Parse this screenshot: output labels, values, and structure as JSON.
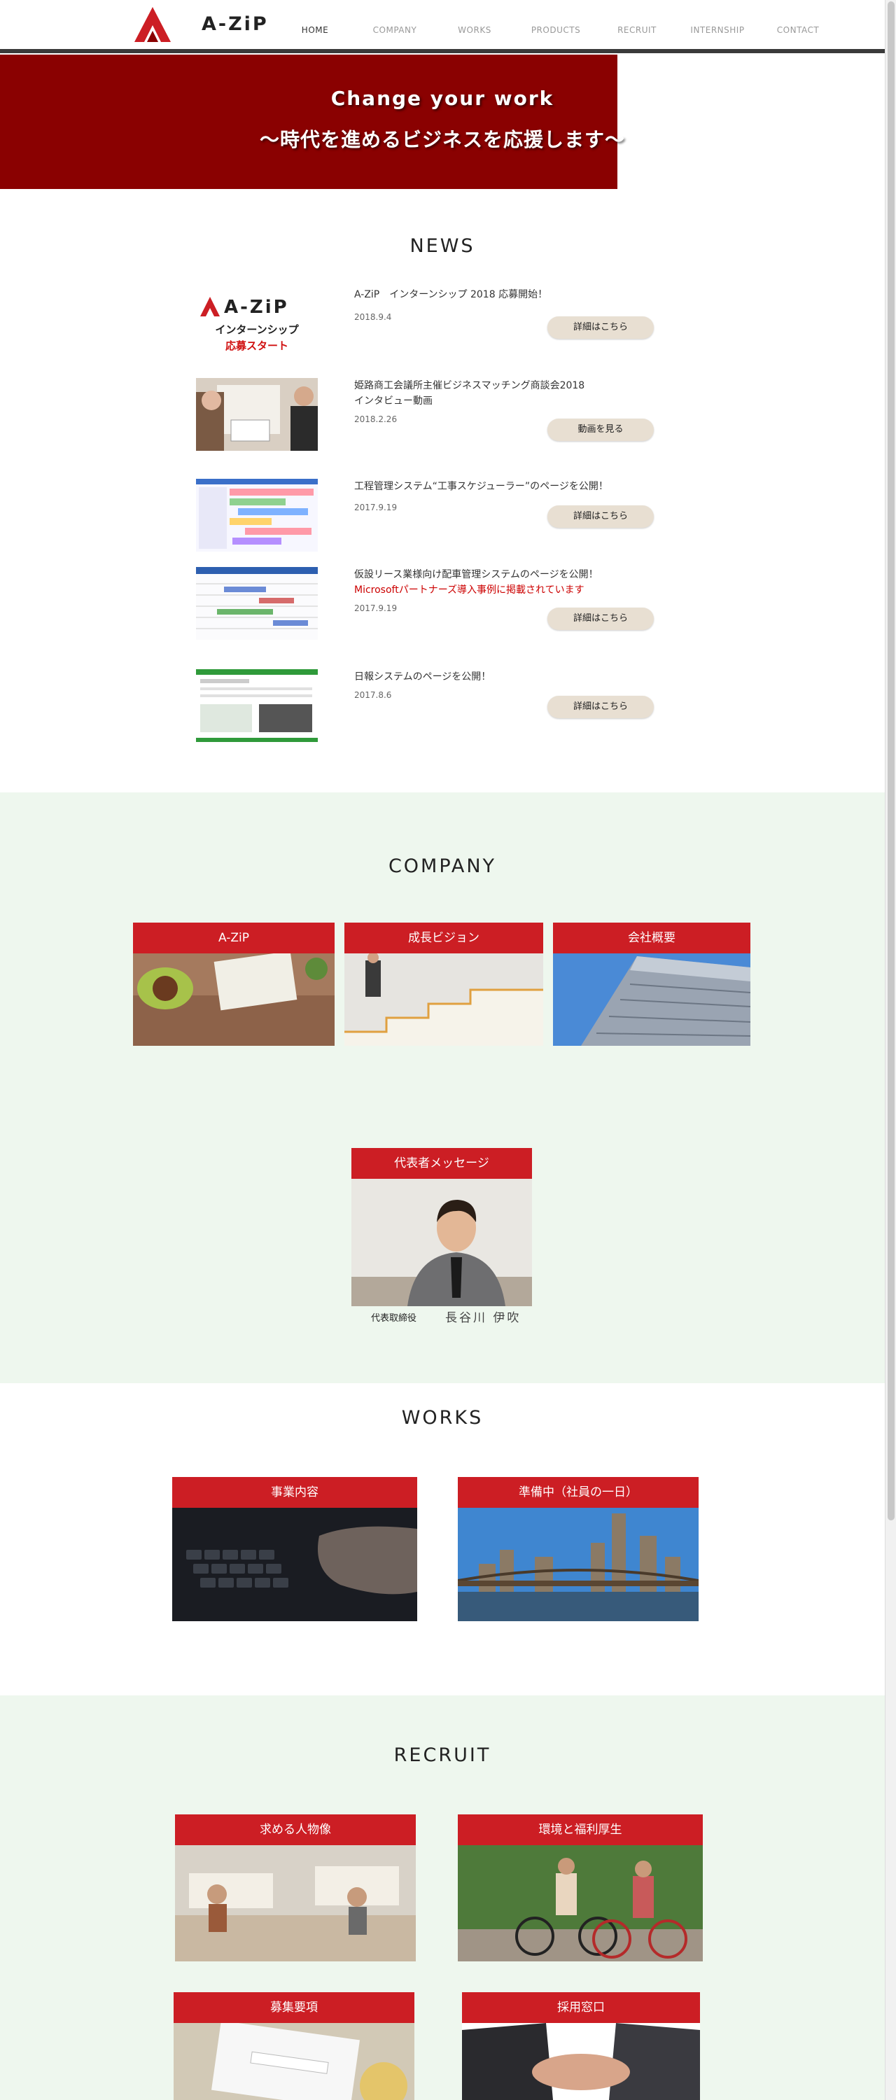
{
  "header": {
    "logo_text": "A-ZiP",
    "nav": [
      {
        "label": "HOME",
        "active": true
      },
      {
        "label": "COMPANY",
        "active": false
      },
      {
        "label": "WORKS",
        "active": false
      },
      {
        "label": "PRODUCTS",
        "active": false
      },
      {
        "label": "RECRUIT",
        "active": false
      },
      {
        "label": "INTERNSHIP",
        "active": false
      },
      {
        "label": "CONTACT",
        "active": false
      }
    ]
  },
  "hero": {
    "title": "Change your work",
    "subtitle": "～時代を進めるビジネスを応援します～"
  },
  "news": {
    "title": "NEWS",
    "thumb1": {
      "logo": "A-ZiP",
      "line1": "インターンシップ",
      "line2": "応募スタート"
    },
    "items": [
      {
        "headline": "A-ZiP　インターンシップ 2018 応募開始！",
        "date": "2018.9.4",
        "button": "詳細はこちら"
      },
      {
        "headline": "姫路商工会議所主催ビジネスマッチング商談会2018",
        "headline2": "インタビュー動画",
        "date": "2018.2.26",
        "button": "動画を見る"
      },
      {
        "headline": "工程管理システム“工事スケジューラー”のページを公開！",
        "date": "2017.9.19",
        "button": "詳細はこちら"
      },
      {
        "headline": "仮設リース業様向け配車管理システムのページを公開！",
        "headline2": "Microsoftパートナーズ導入事例に掲載されています",
        "date": "2017.9.19",
        "button": "詳細はこちら"
      },
      {
        "headline": "日報システムのページを公開！",
        "date": "2017.8.6",
        "button": "詳細はこちら"
      }
    ]
  },
  "company": {
    "title": "COMPANY",
    "cards": [
      {
        "label": "A-ZiP"
      },
      {
        "label": "成長ビジョン"
      },
      {
        "label": "会社概要"
      }
    ],
    "ceo": {
      "label": "代表者メッセージ",
      "role": "代表取締役",
      "name": "長谷川 伊吹"
    }
  },
  "works": {
    "title": "WORKS",
    "cards": [
      {
        "label": "事業内容"
      },
      {
        "label": "準備中（社員の一日）"
      }
    ]
  },
  "recruit": {
    "title": "RECRUIT",
    "cards": [
      {
        "label": "求める人物像"
      },
      {
        "label": "環境と福利厚生"
      },
      {
        "label": "募集要項"
      },
      {
        "label": "採用窓口"
      }
    ]
  },
  "colors": {
    "brand_red": "#cc1e24",
    "hero_red": "#8a0101",
    "green_bg": "#eef7ee",
    "button_beige": "#e8dfd2"
  }
}
